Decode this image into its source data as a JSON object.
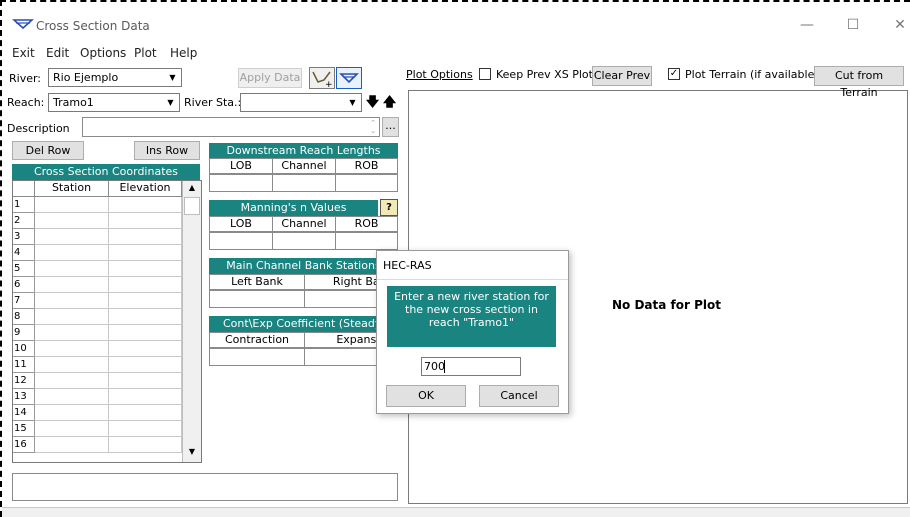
{
  "window": {
    "title": "Cross Section Data",
    "minimize_glyph": "—",
    "maximize_glyph": "☐",
    "close_glyph": "✕"
  },
  "menu": [
    "Exit",
    "Edit",
    "Options",
    "Plot",
    "Help"
  ],
  "river": {
    "label": "River:",
    "value": "Rio Ejemplo"
  },
  "reach": {
    "label": "Reach:",
    "value": "Tramo1"
  },
  "river_sta": {
    "label": "River Sta.:",
    "value": ""
  },
  "apply_data_label": "Apply Data",
  "description": {
    "label": "Description",
    "value": ""
  },
  "ellipsis_label": "...",
  "del_row_label": "Del Row",
  "ins_row_label": "Ins Row",
  "coords": {
    "title": "Cross Section Coordinates",
    "columns": [
      "Station",
      "Elevation"
    ],
    "row_numbers": [
      "1",
      "2",
      "3",
      "4",
      "5",
      "6",
      "7",
      "8",
      "9",
      "10",
      "11",
      "12",
      "13",
      "14",
      "15",
      "16"
    ]
  },
  "downstream": {
    "title": "Downstream Reach Lengths",
    "columns": [
      "LOB",
      "Channel",
      "ROB"
    ]
  },
  "mannings": {
    "title": "Manning's n Values",
    "columns": [
      "LOB",
      "Channel",
      "ROB"
    ],
    "help_glyph": "?"
  },
  "bank_stations": {
    "title": "Main Channel Bank Stations",
    "columns": [
      "Left Bank",
      "Right Bank"
    ]
  },
  "coefficients": {
    "title": "Cont\\Exp Coefficient (Steady",
    "columns": [
      "Contraction",
      "Expansion"
    ]
  },
  "plot": {
    "options_label": "Plot Options",
    "keep_prev_label": "Keep Prev XS Plots",
    "keep_prev_checked": false,
    "clear_prev_label": "Clear Prev",
    "plot_terrain_label": "Plot Terrain (if available)",
    "plot_terrain_checked": true,
    "cut_terrain_label": "Cut from Terrain",
    "no_data_text": "No Data for Plot"
  },
  "dialog": {
    "title": "HEC-RAS",
    "message": "Enter a new river station for the new cross section in reach \"Tramo1\"",
    "input_value": "700",
    "ok_label": "OK",
    "cancel_label": "Cancel"
  },
  "colors": {
    "accent_teal": "#1a8480",
    "window_bg": "#ffffff"
  }
}
